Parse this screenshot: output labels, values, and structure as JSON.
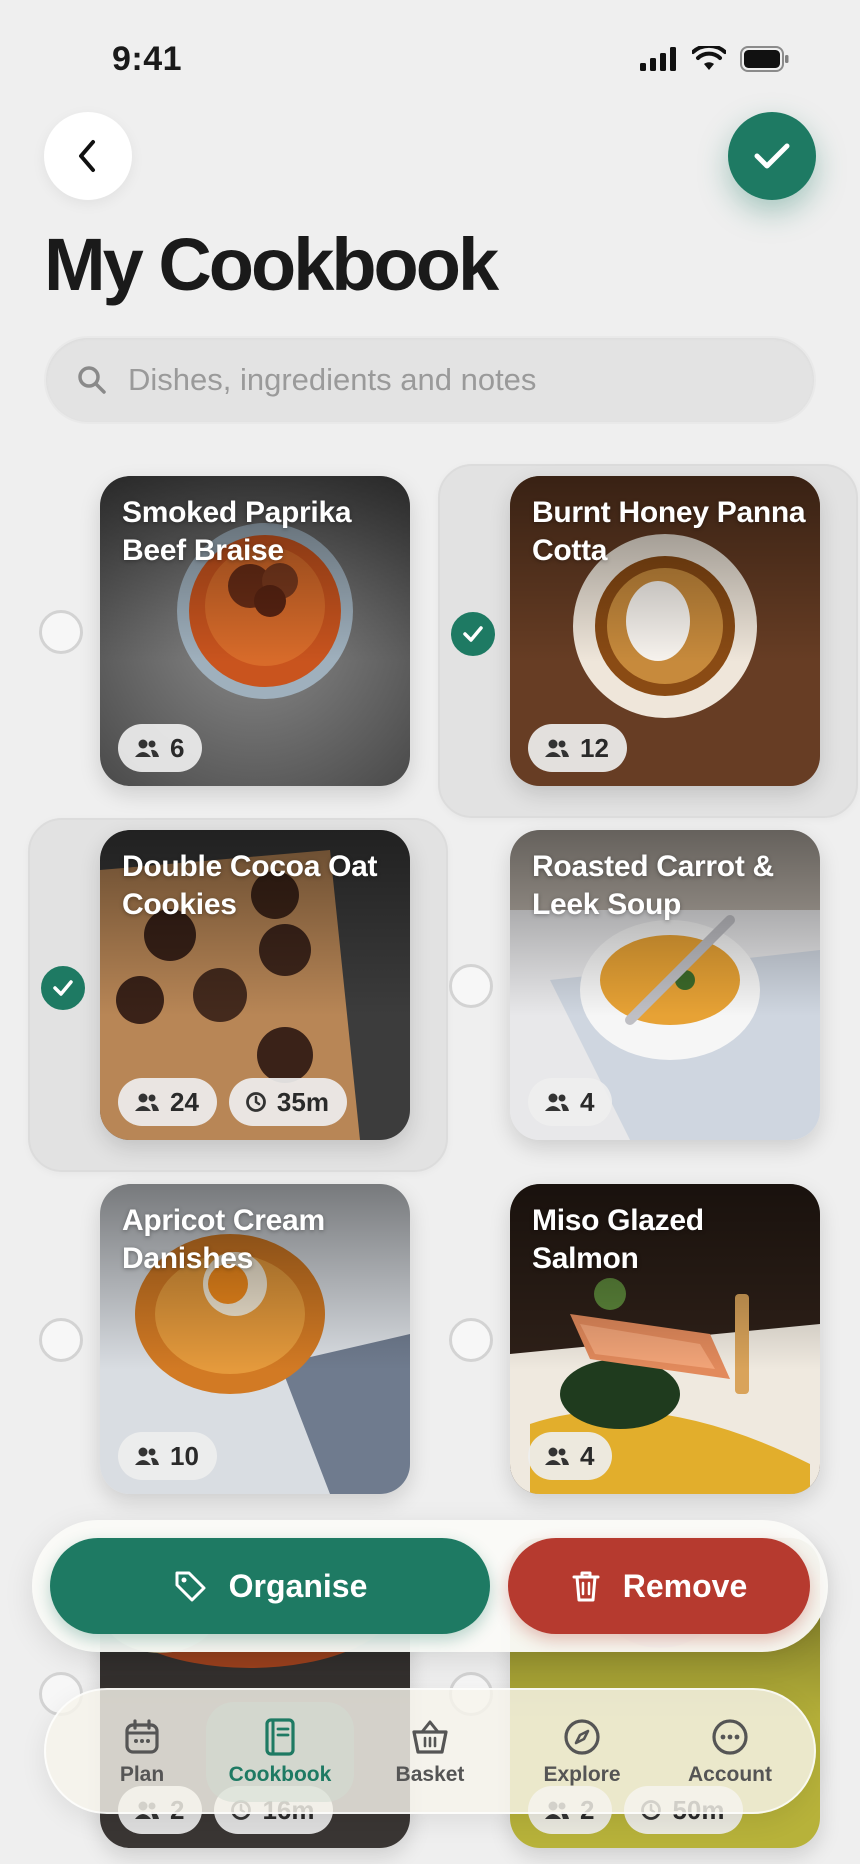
{
  "status_bar": {
    "time": "9:41"
  },
  "header": {
    "title": "My Cookbook"
  },
  "search": {
    "placeholder": "Dishes, ingredients and notes"
  },
  "recipes": [
    {
      "title": "Smoked Paprika Beef Braise",
      "servings": "6",
      "time": "",
      "selected": false
    },
    {
      "title": "Burnt Honey Panna Cotta",
      "servings": "12",
      "time": "",
      "selected": true
    },
    {
      "title": "Double Cocoa Oat Cookies",
      "servings": "24",
      "time": "35m",
      "selected": true
    },
    {
      "title": "Roasted Carrot & Leek Soup",
      "servings": "4",
      "time": "",
      "selected": false
    },
    {
      "title": "Apricot Cream Danishes",
      "servings": "10",
      "time": "",
      "selected": false
    },
    {
      "title": "Miso Glazed Salmon",
      "servings": "4",
      "time": "",
      "selected": false
    },
    {
      "title": "",
      "servings": "2",
      "time": "16m",
      "selected": false
    },
    {
      "title": "",
      "servings": "2",
      "time": "50m",
      "selected": false
    }
  ],
  "actions": {
    "organise_label": "Organise",
    "remove_label": "Remove"
  },
  "tabs": [
    {
      "label": "Plan",
      "icon": "calendar-icon"
    },
    {
      "label": "Cookbook",
      "icon": "book-icon",
      "active": true
    },
    {
      "label": "Basket",
      "icon": "basket-icon"
    },
    {
      "label": "Explore",
      "icon": "compass-icon"
    },
    {
      "label": "Account",
      "icon": "more-icon"
    }
  ],
  "colors": {
    "accent": "#1e7a63",
    "danger": "#b63a2f",
    "background": "#efefef"
  }
}
